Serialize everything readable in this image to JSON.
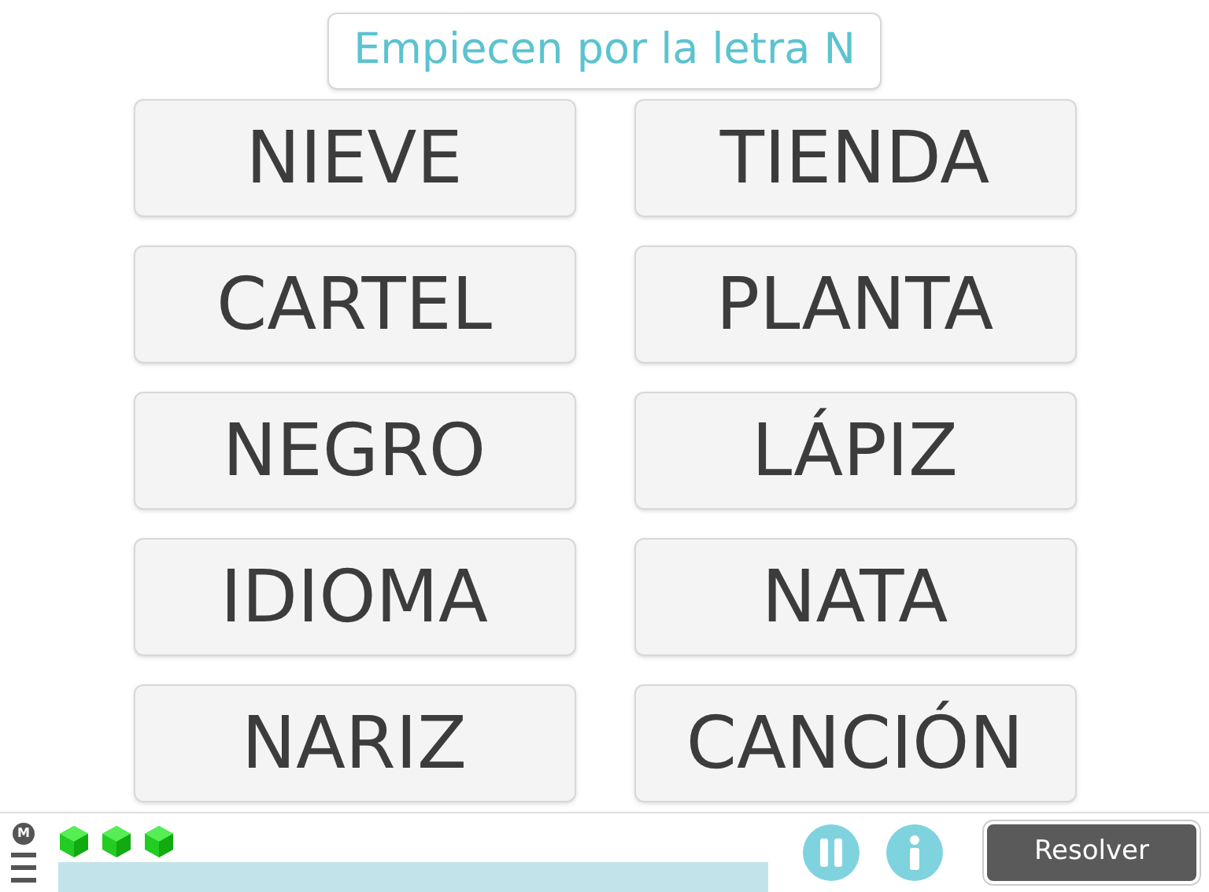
{
  "prompt": "Empiecen por la letra N",
  "words": [
    {
      "text": "NIEVE"
    },
    {
      "text": "TIENDA"
    },
    {
      "text": "CARTEL"
    },
    {
      "text": "PLANTA"
    },
    {
      "text": "NEGRO"
    },
    {
      "text": "LÁPIZ"
    },
    {
      "text": "IDIOMA"
    },
    {
      "text": "NATA"
    },
    {
      "text": "NARIZ"
    },
    {
      "text": "CANCIÓN"
    }
  ],
  "footer": {
    "logo": "M",
    "lives": [
      {
        "kind": "gem"
      },
      {
        "kind": "gem"
      },
      {
        "kind": "gem"
      }
    ],
    "solve_button": "Resolver"
  }
}
